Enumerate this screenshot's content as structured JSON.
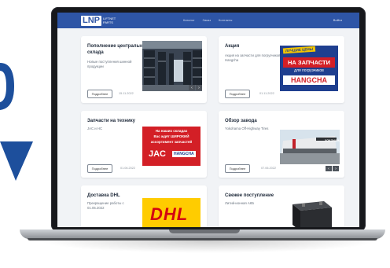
{
  "nav": {
    "logo_mark": "LNP",
    "logo_sub": "LIFTNET PARTS",
    "links": [
      "Каталог",
      "Заказ",
      "Контакты"
    ],
    "right": "Войти"
  },
  "cards": [
    {
      "title": "Пополнение центрального склада",
      "desc": "Новые поступления шинной продукции",
      "button": "Подробнее",
      "date": "15.11.2022"
    },
    {
      "title": "Акция",
      "desc": "Акция на запчасти для погрузчиков Hangcha",
      "button": "Подробнее",
      "date": "01.11.2022",
      "banner_top": "ЛУЧШИЕ ЦЕНЫ",
      "banner_main": "НА ЗАПЧАСТИ",
      "banner_sub": "для погрузчиков",
      "banner_brand": "HANGCHA"
    },
    {
      "title": "Запчасти на технику",
      "desc": "JAC и HC",
      "button": "Подробнее",
      "date": "01.06.2022",
      "banner_line1": "На наших складах",
      "banner_line2": "Вас ждёт ШИРОКИЙ",
      "banner_line3": "ассортимент запчастей",
      "banner_brand1": "JAC",
      "banner_brand2": "HANGCHA"
    },
    {
      "title": "Обзор завода",
      "desc": "Yokohama Off-Highway Tires",
      "button": "Подробнее",
      "date": "07.06.2022",
      "brand": "YOKOHAMA"
    },
    {
      "title": "Доставка DHL",
      "desc": "Прекращение работы с 01.05.2022",
      "button": "",
      "date": "",
      "brand": "DHL"
    },
    {
      "title": "Свежее поступление",
      "desc": "Литий-ионная АКБ",
      "button": "",
      "date": ""
    }
  ],
  "colors": {
    "nav": "#2e55a6",
    "accent_red": "#d31f26",
    "dhl_yellow": "#ffcc00",
    "background": "#f1f3f6"
  }
}
